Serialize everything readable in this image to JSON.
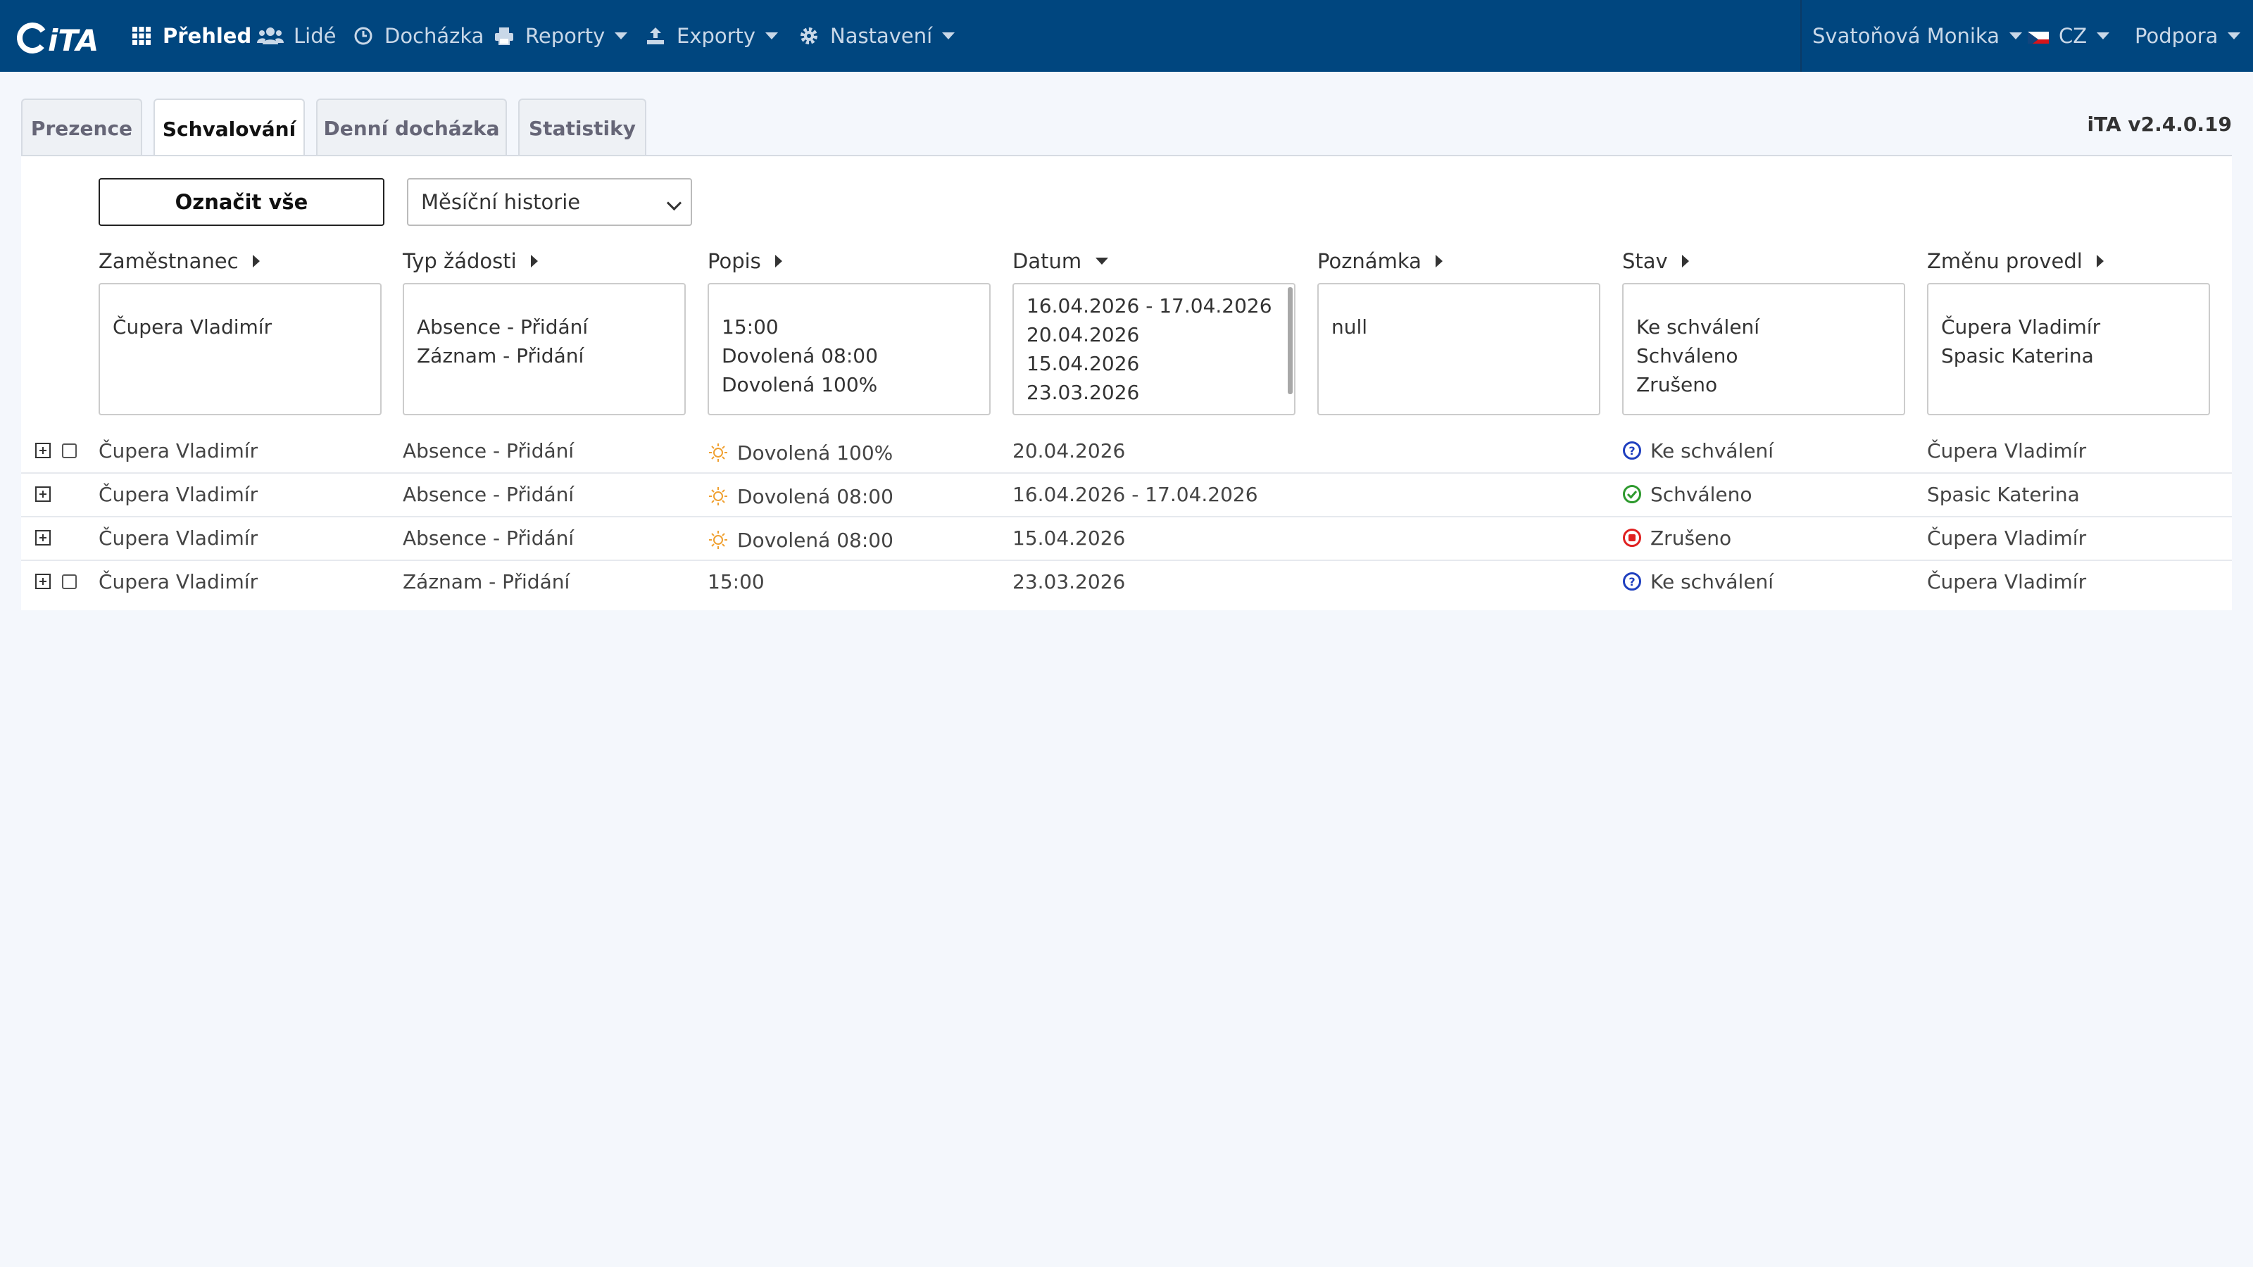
{
  "navbar": {
    "logo": "iTA",
    "items": [
      {
        "label": "Přehled",
        "icon": "grid-icon"
      },
      {
        "label": "Lidé",
        "icon": "users-icon"
      },
      {
        "label": "Docházka",
        "icon": "clock-icon"
      },
      {
        "label": "Reporty",
        "icon": "print-icon"
      },
      {
        "label": "Exporty",
        "icon": "export-icon"
      },
      {
        "label": "Nastavení",
        "icon": "gear-icon"
      }
    ],
    "user": "Svatoňová Monika",
    "language": "CZ",
    "support": "Podpora"
  },
  "tabs": [
    "Prezence",
    "Schvalování",
    "Denní docházka",
    "Statistiky"
  ],
  "active_tab": "Schvalování",
  "version": "iTA v2.4.0.19",
  "toolbar": {
    "mark_all": "Označit vše",
    "history_select": "Měsíční historie"
  },
  "columns": [
    "Zaměstnanec",
    "Typ žádosti",
    "Popis",
    "Datum",
    "Poznámka",
    "Stav",
    "Změnu provedl"
  ],
  "filters": {
    "employee": [
      "Čupera Vladimír"
    ],
    "type": [
      "Absence - Přidání",
      "Záznam - Přidání"
    ],
    "description": [
      "15:00",
      "Dovolená 08:00",
      "Dovolená 100%"
    ],
    "date": [
      "16.04.2026 - 17.04.2026",
      "20.04.2026",
      "15.04.2026",
      "23.03.2026"
    ],
    "note": [
      "null"
    ],
    "status": [
      "Ke schválení",
      "Schváleno",
      "Zrušeno"
    ],
    "changed_by": [
      "Čupera Vladimír",
      "Spasic Katerina"
    ]
  },
  "rows": [
    {
      "employee": "Čupera Vladimír",
      "type": "Absence - Přidání",
      "description": "Dovolená 100%",
      "date": "20.04.2026",
      "note": "",
      "status": "Ke schválení",
      "status_icon": "question-circle-icon",
      "changed_by": "Čupera Vladimír",
      "has_checkbox": true,
      "has_sun": true
    },
    {
      "employee": "Čupera Vladimír",
      "type": "Absence - Přidání",
      "description": "Dovolená 08:00",
      "date": "16.04.2026 - 17.04.2026",
      "note": "",
      "status": "Schváleno",
      "status_icon": "check-circle-icon",
      "changed_by": "Spasic Katerina",
      "has_checkbox": false,
      "has_sun": true
    },
    {
      "employee": "Čupera Vladimír",
      "type": "Absence - Přidání",
      "description": "Dovolená 08:00",
      "date": "15.04.2026",
      "note": "",
      "status": "Zrušeno",
      "status_icon": "stop-circle-icon",
      "changed_by": "Čupera Vladimír",
      "has_checkbox": false,
      "has_sun": true
    },
    {
      "employee": "Čupera Vladimír",
      "type": "Záznam - Přidání",
      "description": "15:00",
      "date": "23.03.2026",
      "note": "",
      "status": "Ke schválení",
      "status_icon": "question-circle-icon",
      "changed_by": "Čupera Vladimír",
      "has_checkbox": true,
      "has_sun": false
    }
  ],
  "colors": {
    "navbar": "#00467f",
    "page_bg": "#f4f7fc",
    "pending": "#1f3fbf",
    "approved": "#2e9a2e",
    "cancelled": "#e02020",
    "sun": "#f0a030"
  }
}
